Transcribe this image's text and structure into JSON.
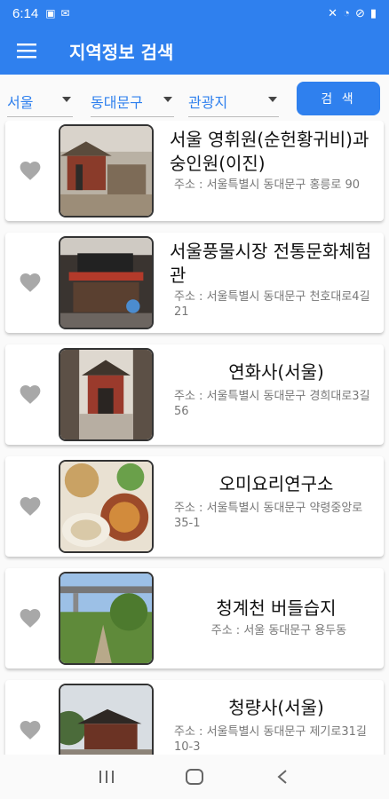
{
  "status_bar": {
    "time": "6:14"
  },
  "app_bar": {
    "title": "지역정보 검색"
  },
  "filters": {
    "region": "서울",
    "district": "동대문구",
    "category": "관광지",
    "search_label": "검 색"
  },
  "items": [
    {
      "title": "서울 영휘원(순헌황귀비)과 숭인원(이진)",
      "address": "주소 : 서울특별시 동대문구 홍릉로 90"
    },
    {
      "title": "서울풍물시장 전통문화체험관",
      "address": "주소 : 서울특별시 동대문구 천호대로4길 21"
    },
    {
      "title": "연화사(서울)",
      "address": "주소 : 서울특별시 동대문구 경희대로3길 56"
    },
    {
      "title": "오미요리연구소",
      "address": "주소 : 서울특별시 동대문구 약령중앙로 35-1"
    },
    {
      "title": "청계천 버들습지",
      "address": "주소 : 서울 동대문구 용두동"
    },
    {
      "title": "청량사(서울)",
      "address": "주소 : 서울특별시 동대문구 제기로31길 10-3"
    }
  ]
}
